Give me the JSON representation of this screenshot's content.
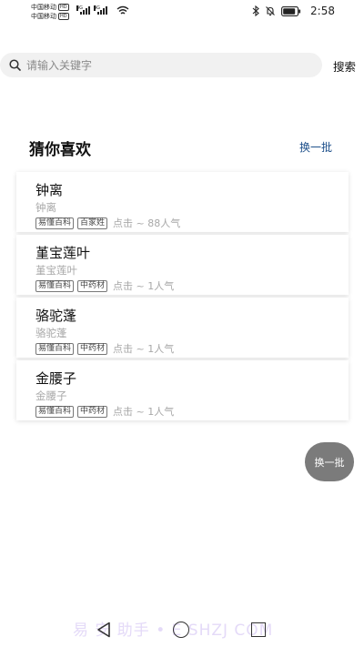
{
  "status_bar": {
    "carrier_1": "中国移动",
    "carrier_2": "中国移动",
    "hd_badge": "HD",
    "network_1": "4G",
    "network_2": "4G",
    "time": "2:58"
  },
  "search": {
    "placeholder": "请输入关键字",
    "button_label": "搜索"
  },
  "section": {
    "title": "猜你喜欢",
    "refresh_label": "换一批"
  },
  "items": [
    {
      "title": "钟离",
      "subtitle": "钟离",
      "tags": [
        "易懂百科",
        "百家姓"
      ],
      "clicks": "点击 ~ 88人气"
    },
    {
      "title": "堇宝莲叶",
      "subtitle": "堇宝莲叶",
      "tags": [
        "易懂百科",
        "中药材"
      ],
      "clicks": "点击 ~ 1人气"
    },
    {
      "title": "骆驼蓬",
      "subtitle": "骆驼蓬",
      "tags": [
        "易懂百科",
        "中药材"
      ],
      "clicks": "点击 ~ 1人气"
    },
    {
      "title": "金腰子",
      "subtitle": "金腰子",
      "tags": [
        "易懂百科",
        "中药材"
      ],
      "clicks": "点击 ~ 1人气"
    }
  ],
  "fab": {
    "label": "换一批"
  },
  "watermark": "易 安 助手 • E    SHZJ     COM"
}
